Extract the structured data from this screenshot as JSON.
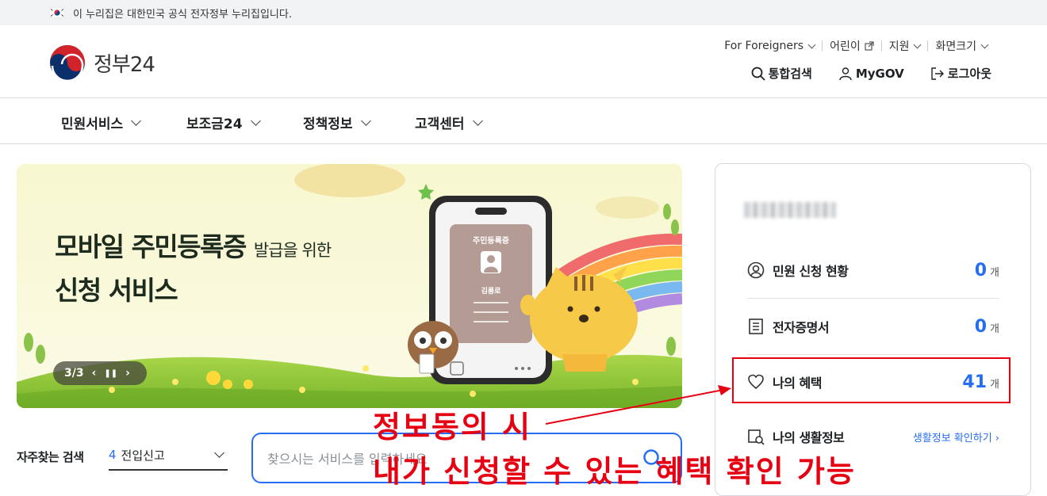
{
  "topbar": {
    "notice": "이 누리집은 대한민국 공식 전자정부 누리집입니다.",
    "flag_icon": "korea-flag-icon"
  },
  "header": {
    "logo_text": "정부24",
    "utils": [
      {
        "label": "For Foreigners",
        "icon": "chevron-down-icon"
      },
      {
        "label": "어린이",
        "icon": "external-link-icon"
      },
      {
        "label": "지원",
        "icon": "chevron-down-icon"
      },
      {
        "label": "화면크기",
        "icon": "chevron-down-icon"
      }
    ],
    "actions": [
      {
        "label": "통합검색",
        "icon": "search-icon"
      },
      {
        "label": "MyGOV",
        "icon": "user-icon"
      },
      {
        "label": "로그아웃",
        "icon": "logout-icon"
      }
    ]
  },
  "gnb": [
    "민원서비스",
    "보조금24",
    "정책정보",
    "고객센터"
  ],
  "banner": {
    "title_line1": "모바일 주민등록증",
    "title_line1_small": "발급을 위한",
    "title_line2": "신청 서비스",
    "pager": "3/3",
    "card_title": "주민등록증",
    "card_name": "김룡로"
  },
  "mypanel": {
    "rows": [
      {
        "label": "민원 신청 현황",
        "count": "0",
        "unit": "개",
        "icon": "user-circle-icon"
      },
      {
        "label": "전자증명서",
        "count": "0",
        "unit": "개",
        "icon": "document-icon"
      },
      {
        "label": "나의 혜택",
        "count": "41",
        "unit": "개",
        "icon": "heart-icon"
      },
      {
        "label": "나의 생활정보",
        "link": "생활정보 확인하기 ›",
        "icon": "search-document-icon"
      }
    ]
  },
  "frequent": {
    "label": "자주찾는 검색",
    "rank": "4",
    "value": "전입신고"
  },
  "search": {
    "placeholder": "찾으시는 서비스를 입력하세요"
  },
  "annotation": {
    "line1": "정보동의 시",
    "line2": "내가 신청할 수 있는 혜택 확인 가능",
    "color": "#e60012"
  }
}
